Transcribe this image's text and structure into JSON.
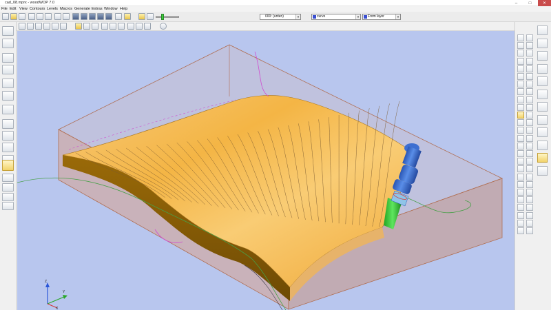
{
  "window": {
    "title": "cad_08.mprx - woodWOP 7.0",
    "minimize": "–",
    "maximize": "□",
    "close": "✕"
  },
  "menu": [
    "File",
    "Edit",
    "View",
    "Contours",
    "Levels",
    "Macros",
    "Generate",
    "Extras",
    "Window",
    "Help"
  ],
  "toolbar": {
    "level_combo": "000: (unten)",
    "type_combo": "curve",
    "color_combo": "From layer",
    "type_swatch_color": "#3b4fd0",
    "color_swatch_color": "#3b4fd0"
  },
  "axes": {
    "z": "Z",
    "y": "Y",
    "x": "X"
  },
  "colors": {
    "viewport_bg": "#b8c6ee",
    "surface": "#f3b24a",
    "block": "#d9a79a",
    "tool_head": "#3d6fd1",
    "tool_shaft": "#3ccc3c"
  }
}
